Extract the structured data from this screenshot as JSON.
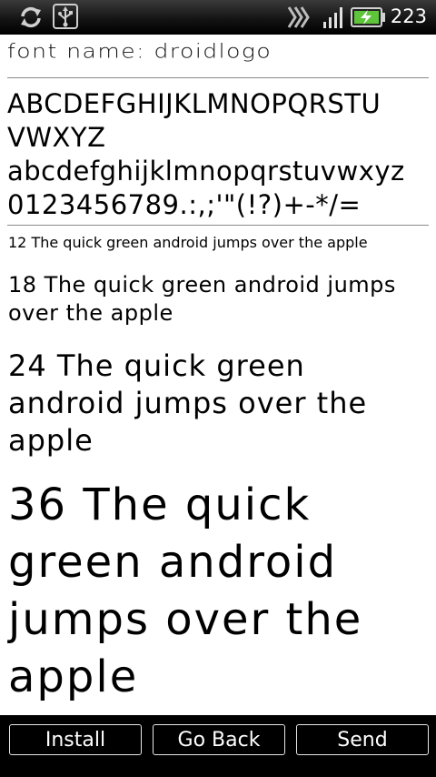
{
  "status_bar": {
    "time": "223",
    "icons": [
      "sync-icon",
      "usb-icon",
      "data-activity-icon",
      "signal-icon",
      "battery-charging-icon"
    ]
  },
  "font_name_label": "font name: droidlogo",
  "charset": {
    "uppercase_line1": "ABCDEFGHIJKLMNOPQRSTU",
    "uppercase_line2": "VWXYZ",
    "lowercase": "abcdefghijklmnopqrstuvwxyz",
    "digits_symbols": "0123456789.:,;'\"(!?)+-*/="
  },
  "samples": {
    "size12": "12 The quick green android jumps over the apple",
    "size18": "18 The quick green android jumps over the apple",
    "size24": "24 The quick green android jumps over the apple",
    "size36": "36 The quick green android jumps over the apple"
  },
  "buttons": {
    "install": "Install",
    "go_back": "Go Back",
    "send": "Send"
  }
}
